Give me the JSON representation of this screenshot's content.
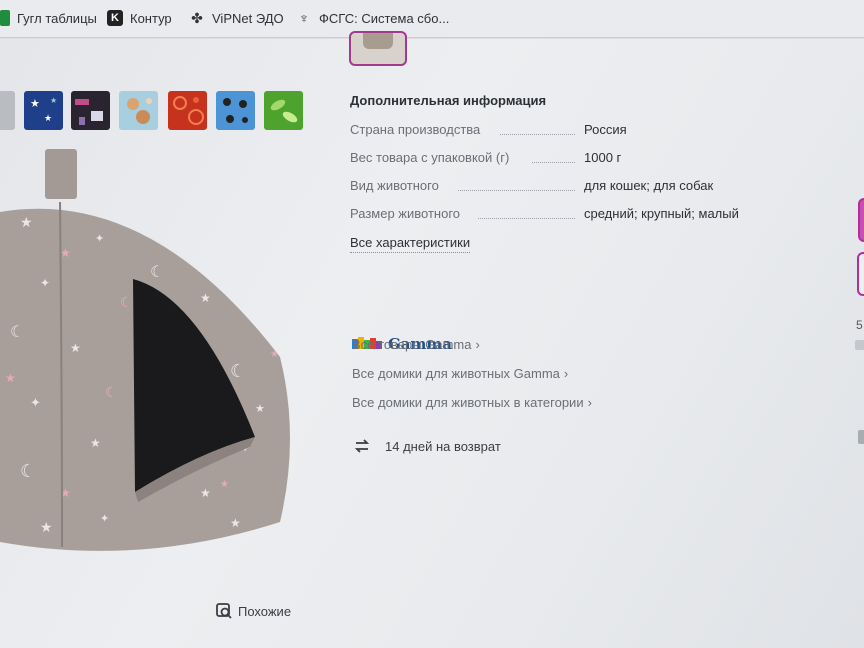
{
  "bookmarks": [
    {
      "label": "Гугл таблицы",
      "icon": "google-sheets-icon"
    },
    {
      "label": "Контур",
      "icon": "kontur-icon"
    },
    {
      "label": "ViPNet ЭДО",
      "icon": "vipnet-icon"
    },
    {
      "label": "ФСГС: Система сбо...",
      "icon": "fsgs-emblem-icon"
    }
  ],
  "info": {
    "title": "Дополнительная информация",
    "specs": [
      {
        "key": "Страна производства",
        "value": "Россия"
      },
      {
        "key": "Вес товара с упаковкой (г)",
        "value": "1000 г"
      },
      {
        "key": "Вид животного",
        "value": "для кошек; для собак"
      },
      {
        "key": "Размер животного",
        "value": "средний; крупный; малый"
      }
    ],
    "all_characteristics": "Все характеристики"
  },
  "brand": {
    "name": "Gamma",
    "links": [
      "Все товары Gamma",
      "Все домики для животных Gamma",
      "Все домики для животных в категории"
    ]
  },
  "returns": {
    "label": "14 дней на возврат"
  },
  "similar": {
    "label": "Похожие"
  },
  "edge": {
    "text": "5"
  },
  "colors": {
    "accent": "#a23a8d",
    "brand": "#1f4f8a"
  }
}
